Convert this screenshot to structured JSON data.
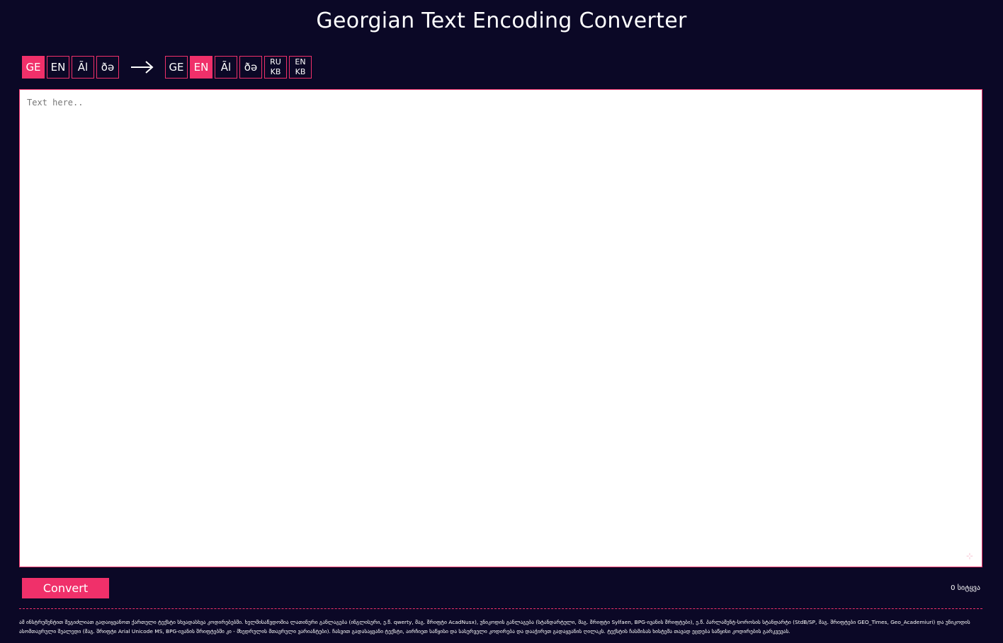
{
  "title": "Georgian Text Encoding Converter",
  "source_encodings": [
    {
      "label": "GE",
      "active": true
    },
    {
      "label": "EN",
      "active": false
    },
    {
      "label": "Ãl",
      "active": false
    },
    {
      "label": "ðə",
      "active": false
    }
  ],
  "target_encodings": [
    {
      "label": "GE",
      "active": false
    },
    {
      "label": "EN",
      "active": true
    },
    {
      "label": "Ãl",
      "active": false
    },
    {
      "label": "ðə",
      "active": false
    },
    {
      "label_top": "RU",
      "label_bottom": "KB",
      "active": false
    },
    {
      "label_top": "EN",
      "label_bottom": "KB",
      "active": false
    }
  ],
  "editor": {
    "placeholder": "Text here..",
    "value": ""
  },
  "convert_label": "Convert",
  "char_count": "0 სიტყვა",
  "footer_text": "ამ ინსტრუმენტით შეგიძლიათ გადაიყვანოთ ქართული ტექსტი სხვადასხვა კოდირებებში. ხელმისაწვდომია ლათინური განლაგება (ინგლისური, ე.წ. qwerty, მაგ. შრიფტი AcadNusx), უნიკოდის განლაგება (სტანდარტული, მაგ. შრიფტი Sylfaen, BPG-ივანის შრიფტები), ე.წ. პარლამენტ-სოროსის სტანდარტი (StdB/SP, მაგ. შრიფტები GEO_Times, Geo_Academiuri) და უნიკოდის ასომთავრული შეალედი (მაგ. შრიფტი Arial Unicode MS, BPG-ივანის შრიფტებში კი - მხედრულის მთავრული ვარიანტები). ჩასვით გადასაყვანი ტექსტი, აირჩიეთ საწყისი და სასურველი კოდირება და დააჭირეთ გადაყვანის ღილაკს. ტექსტის ჩასმისას ხისტემა თავად ეცდება საწყისი კოდირების გარკვევას.",
  "colors": {
    "accent": "#f0306a",
    "background": "#0b0826"
  }
}
